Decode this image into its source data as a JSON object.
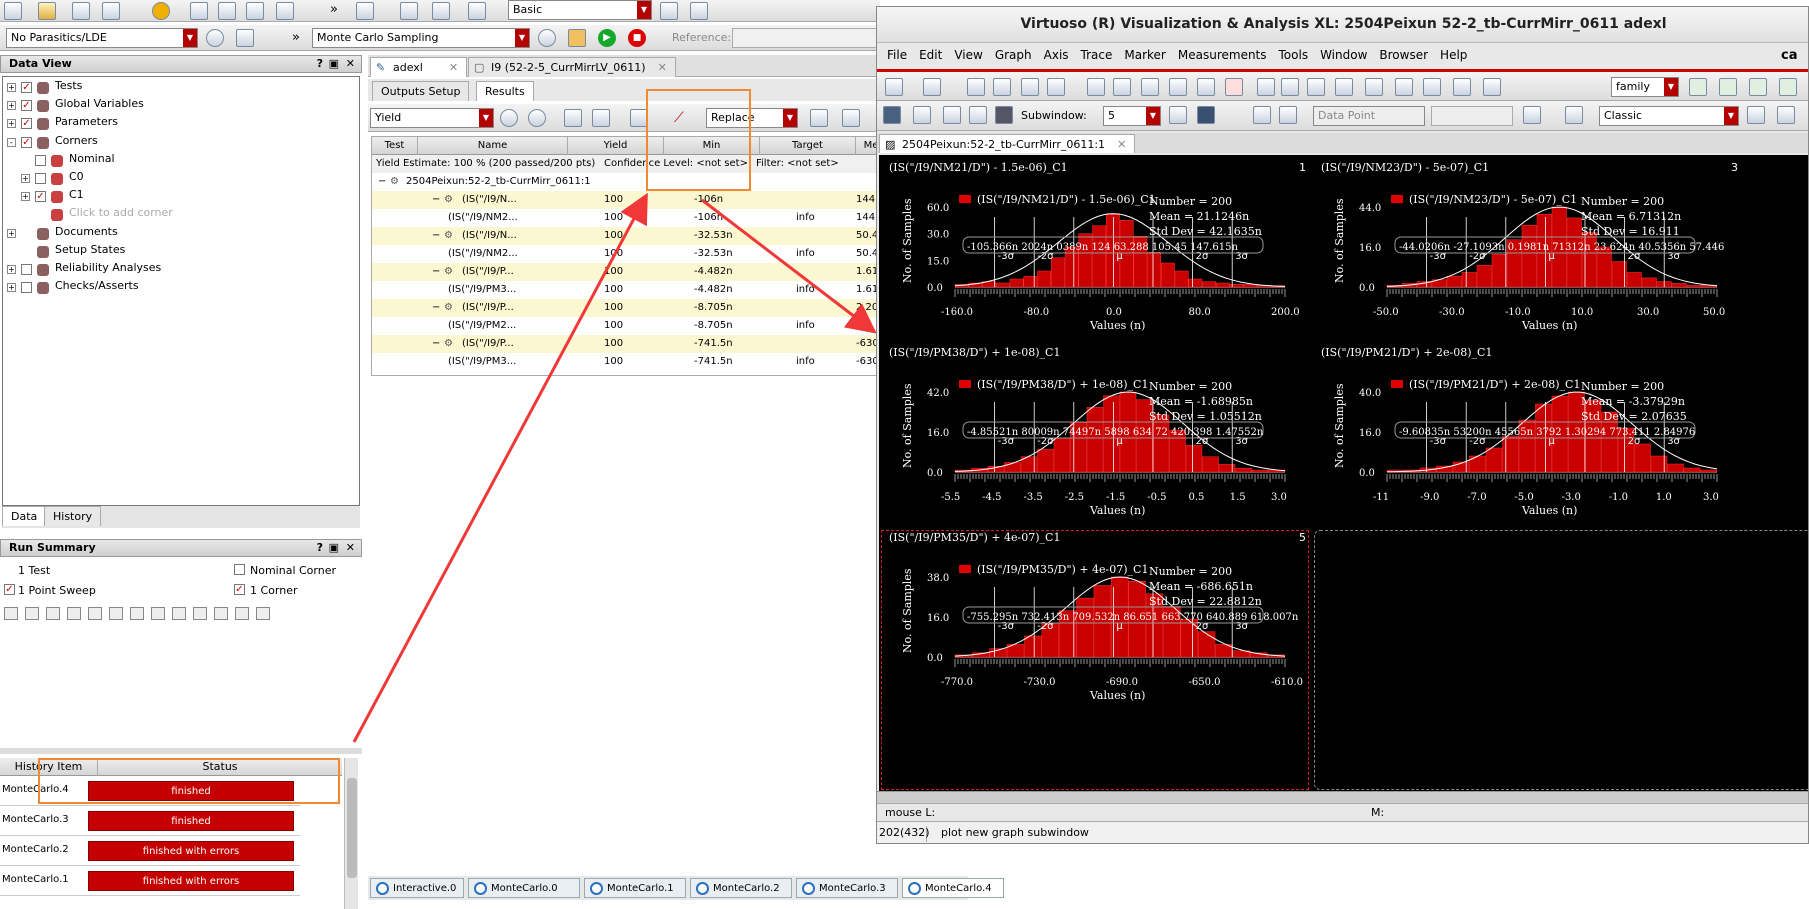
{
  "left_toolbar": {
    "parasitics": "No Parasitics/LDE",
    "sampling": "Monte Carlo Sampling",
    "mode": "Basic",
    "reference_label": "Reference:"
  },
  "data_view": {
    "title": "Data View",
    "items": [
      {
        "label": "Tests",
        "level": 0,
        "exp": "+",
        "checked": true
      },
      {
        "label": "Global Variables",
        "level": 0,
        "exp": "+",
        "checked": true
      },
      {
        "label": "Parameters",
        "level": 0,
        "exp": "+",
        "checked": true
      },
      {
        "label": "Corners",
        "level": 0,
        "exp": "-",
        "checked": true
      },
      {
        "label": "Nominal",
        "level": 1,
        "exp": "",
        "checked": false
      },
      {
        "label": "C0",
        "level": 1,
        "exp": "+",
        "checked": false
      },
      {
        "label": "C1",
        "level": 1,
        "exp": "+",
        "checked": true
      },
      {
        "label": "Click to add corner",
        "level": 1,
        "exp": "",
        "checked": null
      },
      {
        "label": "Documents",
        "level": 0,
        "exp": "+",
        "checked": null
      },
      {
        "label": "Setup States",
        "level": 0,
        "exp": "",
        "checked": null
      },
      {
        "label": "Reliability Analyses",
        "level": 0,
        "exp": "+",
        "checked": false
      },
      {
        "label": "Checks/Asserts",
        "level": 0,
        "exp": "+",
        "checked": false
      }
    ],
    "tabs": [
      "Data",
      "History"
    ]
  },
  "run_summary": {
    "title": "Run Summary",
    "test": "1 Test",
    "nominal": "Nominal Corner",
    "sweep": "1 Point Sweep",
    "corner": "1 Corner"
  },
  "history": {
    "headers": [
      "History Item",
      "Status"
    ],
    "rows": [
      {
        "item": "MonteCarlo.4",
        "status": "finished"
      },
      {
        "item": "MonteCarlo.3",
        "status": "finished"
      },
      {
        "item": "MonteCarlo.2",
        "status": "finished with errors"
      },
      {
        "item": "MonteCarlo.1",
        "status": "finished with errors"
      }
    ]
  },
  "center": {
    "doc_tabs": [
      "adexl",
      "I9 (52-2-5_CurrMirrLV_0611)"
    ],
    "sub_tabs": [
      "Outputs Setup",
      "Results"
    ],
    "view": "Yield",
    "replace": "Replace",
    "columns": [
      "Test",
      "Name",
      "Yield",
      "Min",
      "Target",
      "Me"
    ],
    "estimate": "Yield Estimate: 100 % (200 passed/200 pts)",
    "confidence": "Confidence Level: <not set>",
    "filter": "Filter: <not set>",
    "test_name": "2504Peixun:52-2_tb-CurrMirr_0611:1",
    "rows": [
      {
        "name": "(IS(\"/I9/N...",
        "yield": "100",
        "min": "-106n",
        "target": "",
        "me": "144.",
        "group": true
      },
      {
        "name": "(IS(\"/I9/NM2...",
        "yield": "100",
        "min": "-106n",
        "target": "info",
        "me": "144.",
        "group": false
      },
      {
        "name": "(IS(\"/I9/N...",
        "yield": "100",
        "min": "-32.53n",
        "target": "",
        "me": "50.4",
        "group": true
      },
      {
        "name": "(IS(\"/I9/NM2...",
        "yield": "100",
        "min": "-32.53n",
        "target": "info",
        "me": "50.4",
        "group": false
      },
      {
        "name": "(IS(\"/I9/P...",
        "yield": "100",
        "min": "-4.482n",
        "target": "",
        "me": "1.61",
        "group": true
      },
      {
        "name": "(IS(\"/I9/PM3...",
        "yield": "100",
        "min": "-4.482n",
        "target": "info",
        "me": "1.61",
        "group": false
      },
      {
        "name": "(IS(\"/I9/P...",
        "yield": "100",
        "min": "-8.705n",
        "target": "",
        "me": "2.20",
        "group": true
      },
      {
        "name": "(IS(\"/I9/PM2...",
        "yield": "100",
        "min": "-8.705n",
        "target": "info",
        "me": "2.2",
        "group": false
      },
      {
        "name": "(IS(\"/I9/P...",
        "yield": "100",
        "min": "-741.5n",
        "target": "",
        "me": "-630",
        "group": true
      },
      {
        "name": "(IS(\"/I9/PM3...",
        "yield": "100",
        "min": "-741.5n",
        "target": "info",
        "me": "-630",
        "group": false
      }
    ]
  },
  "bottom_tabs": [
    "Interactive.0",
    "MonteCarlo.0",
    "MonteCarlo.1",
    "MonteCarlo.2",
    "MonteCarlo.3",
    "MonteCarlo.4"
  ],
  "viva": {
    "title": "Virtuoso (R) Visualization & Analysis XL: 2504Peixun 52-2_tb-CurrMirr_0611 adexl",
    "menu": [
      "File",
      "Edit",
      "View",
      "Graph",
      "Axis",
      "Trace",
      "Marker",
      "Measurements",
      "Tools",
      "Window",
      "Browser",
      "Help"
    ],
    "brand": "ca",
    "family": "family",
    "subwindow_label": "Subwindow:",
    "subwindow": "5",
    "data_point": "Data Point",
    "style": "Classic",
    "tab": "2504Peixun:52-2_tb-CurrMirr_0611:1",
    "mouse": "mouse L:",
    "m_label": "M:",
    "counter": "202(432)",
    "status": "plot new graph subwindow"
  },
  "chart_data": [
    {
      "type": "histogram",
      "title": "(IS(\"/I9/NM21/D\") - 1.5e-06)_C1",
      "index": "1",
      "legend": "(IS(\"/I9/NM21/D\") - 1.5e-06)_C1",
      "stats": [
        "Number = 200",
        "Mean = 21.1246n",
        "Std Dev = 42.1635n"
      ],
      "sigma_labels": [
        "-105.366n",
        "2024n",
        "0389n",
        "124",
        "63.288",
        "105.45",
        "147.615n"
      ],
      "xlabel": "Values (n)",
      "ylabel": "No. of Samples",
      "xticks": [
        "-160.0",
        "-80.0",
        "0.0",
        "80.0",
        "200.0"
      ],
      "yticks": [
        "60.0",
        "30.0",
        "15.0",
        "0.0"
      ],
      "xlim": [
        -160,
        200
      ],
      "ylim": [
        0,
        60
      ],
      "bins": [
        2,
        3,
        4,
        3,
        6,
        8,
        12,
        22,
        30,
        40,
        46,
        55,
        50,
        38,
        26,
        18,
        12,
        6,
        4,
        3,
        2,
        2,
        1,
        1
      ],
      "sigma_marks": [
        "-3σ",
        "-2σ",
        "μ",
        "2σ",
        "3σ"
      ]
    },
    {
      "type": "histogram",
      "title": "(IS(\"/I9/NM23/D\") - 5e-07)_C1",
      "index": "3",
      "legend": "(IS(\"/I9/NM23/D\") - 5e-07)_C1",
      "stats": [
        "Number = 200",
        "Mean = 6.71312n",
        "Std Dev = 16.911"
      ],
      "sigma_labels": [
        "-44.0206n",
        "-27.1093n",
        "0.1981n",
        "71312n",
        "23.624n",
        "40.5356n",
        "57.446"
      ],
      "xlabel": "Values (n)",
      "ylabel": "No. of Samples",
      "xticks": [
        "-50.0",
        "-30.0",
        "-10.0",
        "10.0",
        "30.0",
        "50.0"
      ],
      "yticks": [
        "44.0",
        "16.0",
        "0.0"
      ],
      "xlim": [
        -50,
        60
      ],
      "ylim": [
        0,
        44
      ],
      "bins": [
        1,
        2,
        3,
        4,
        6,
        8,
        12,
        18,
        26,
        34,
        40,
        44,
        38,
        30,
        22,
        14,
        8,
        5,
        3,
        2,
        1,
        1
      ],
      "sigma_marks": [
        "-3σ",
        "-2σ",
        "μ",
        "2σ",
        "3σ"
      ]
    },
    {
      "type": "histogram",
      "title": "(IS(\"/I9/PM38/D\") + 1e-08)_C1",
      "index": "",
      "legend": "(IS(\"/I9/PM38/D\") + 1e-08)_C1",
      "stats": [
        "Number = 200",
        "Mean = -1.68985n",
        "Std Dev = 1.05512n"
      ],
      "sigma_labels": [
        "-4.85521n",
        "80009n",
        "74497n",
        "5898",
        "634",
        "72",
        "420.398",
        "1.47552n"
      ],
      "xlabel": "Values (n)",
      "ylabel": "No. of Samples",
      "xticks": [
        "-5.5",
        "-4.5",
        "-3.5",
        "-2.5",
        "-1.5",
        "-0.5",
        "0.5",
        "1.5",
        "3.0"
      ],
      "yticks": [
        "42.0",
        "16.0",
        "0.0"
      ],
      "xlim": [
        -5.5,
        3
      ],
      "ylim": [
        0,
        42
      ],
      "bins": [
        1,
        2,
        3,
        5,
        8,
        12,
        18,
        26,
        34,
        40,
        42,
        38,
        30,
        22,
        14,
        8,
        4,
        2,
        1,
        1
      ],
      "sigma_marks": [
        "-3σ",
        "-2σ",
        "μ",
        "2σ",
        "3σ"
      ]
    },
    {
      "type": "histogram",
      "title": "(IS(\"/I9/PM21/D\") + 2e-08)_C1",
      "index": "",
      "legend": "(IS(\"/I9/PM21/D\") + 2e-08)_C1",
      "stats": [
        "Number = 200",
        "Mean = -3.37929n",
        "Std Dev = 2.07635"
      ],
      "sigma_labels": [
        "-9.60835n",
        "53200n",
        "45565n",
        "3792",
        "1.30294",
        "773.411",
        "2.84976"
      ],
      "xlabel": "Values (n)",
      "ylabel": "No. of Samples",
      "xticks": [
        "-11",
        "-9.0",
        "-7.0",
        "-5.0",
        "-3.0",
        "-1.0",
        "1.0",
        "3.0"
      ],
      "yticks": [
        "40.0",
        "16.0",
        "0.0"
      ],
      "xlim": [
        -11,
        3.5
      ],
      "ylim": [
        0,
        40
      ],
      "bins": [
        1,
        1,
        2,
        3,
        5,
        8,
        12,
        18,
        26,
        34,
        38,
        40,
        36,
        30,
        22,
        14,
        8,
        4,
        2,
        1
      ],
      "sigma_marks": [
        "-3σ",
        "-2σ",
        "μ",
        "2σ",
        "3σ"
      ]
    },
    {
      "type": "histogram",
      "title": "(IS(\"/I9/PM35/D\") + 4e-07)_C1",
      "index": "5",
      "legend": "(IS(\"/I9/PM35/D\") + 4e-07)_C1",
      "stats": [
        "Number = 200",
        "Mean = -686.651n",
        "Std Dev = 22.8812n"
      ],
      "sigma_labels": [
        "-755.295n",
        "732.413n",
        "709.532n",
        "86.651",
        "663.770",
        "640.889",
        "618.007n"
      ],
      "xlabel": "Values (n)",
      "ylabel": "No. of Samples",
      "xticks": [
        "-770.0",
        "-730.0",
        "-690.0",
        "-650.0",
        "-610.0"
      ],
      "yticks": [
        "38.0",
        "16.0",
        "0.0"
      ],
      "xlim": [
        -770,
        -610
      ],
      "ylim": [
        0,
        38
      ],
      "bins": [
        1,
        2,
        4,
        6,
        10,
        16,
        22,
        28,
        34,
        38,
        36,
        30,
        24,
        18,
        12,
        6,
        3,
        2,
        1
      ],
      "sigma_marks": [
        "-3σ",
        "-2σ",
        "μ",
        "2σ",
        "3σ"
      ]
    }
  ]
}
